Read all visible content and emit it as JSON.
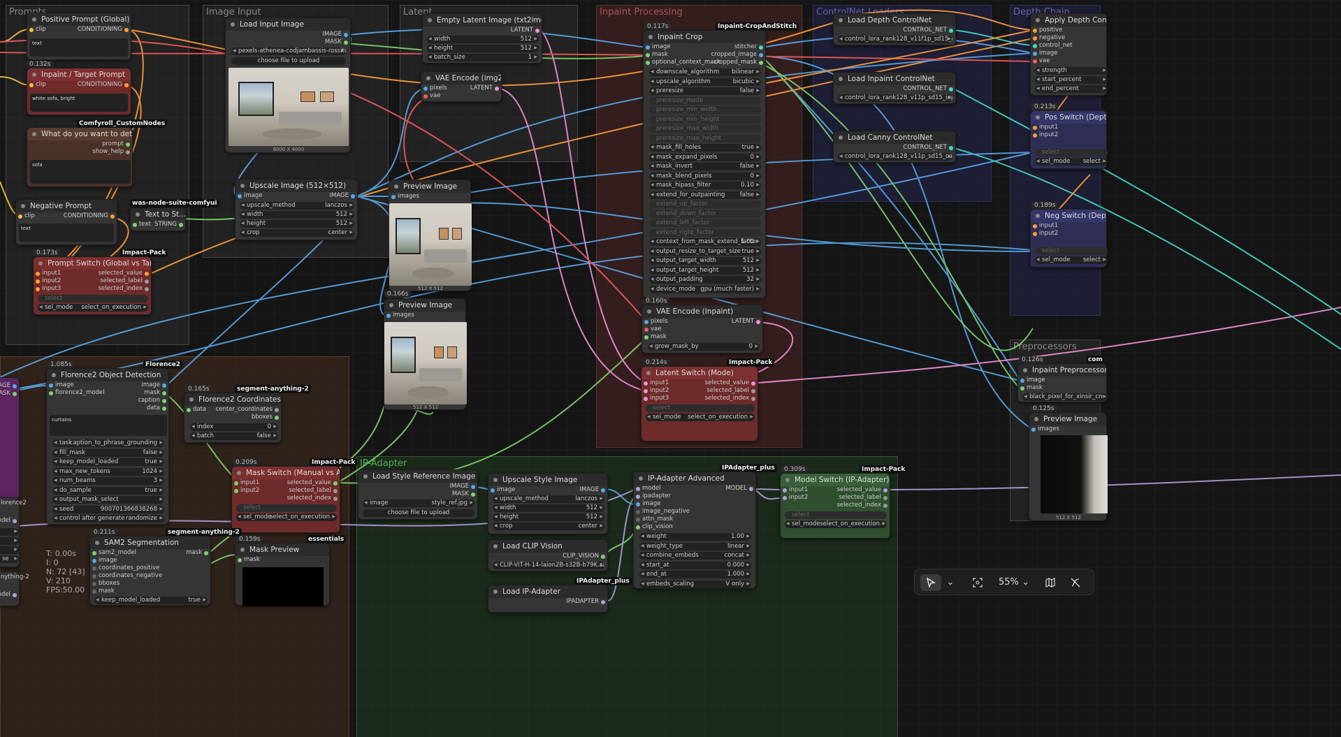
{
  "groups": {
    "prompts": "Prompts",
    "image_input": "Image Input",
    "latent": "Latent",
    "inpaint": "Inpaint Processing",
    "controlnet": "ControlNet Loaders",
    "depth": "Depth Chain",
    "ipadapter": "IP-Adapter",
    "preprocessors": "Preprocessors"
  },
  "nodes": {
    "pos_prompt": {
      "title": "Positive Prompt (Global)",
      "clip": "clip",
      "out": "CONDITIONING",
      "text": "text"
    },
    "inpaint_prompt": {
      "time": "0.132s",
      "title": "Inpaint / Target Prompt",
      "clip": "clip",
      "out": "CONDITIONING",
      "text": "white sofa, bright",
      "tag": "Comfyroll_CustomNodes"
    },
    "detect": {
      "title": "What do you want to detect ?",
      "o1": "prompt",
      "o2": "show_help",
      "text": "sofa"
    },
    "neg_prompt": {
      "title": "Negative Prompt",
      "clip": "clip",
      "out": "CONDITIONING",
      "text": "text",
      "tag": "was-node-suite-comfyui"
    },
    "text_to_str": {
      "title": "Text to St...",
      "in": "text",
      "out": "STRING"
    },
    "prompt_switch": {
      "time": "0.173s",
      "tag": "Impact-Pack",
      "title": "Prompt Switch (Global vs Target)",
      "i1": "input1",
      "i2": "input2",
      "i3": "input3",
      "o1": "selected_value",
      "o2": "selected_label",
      "o3": "selected_index",
      "select": "select",
      "sel_mode": "sel_mode",
      "sel_val": "select_on_execution"
    },
    "load_image": {
      "title": "Load Input Image",
      "o1": "IMAGE",
      "o2": "MASK",
      "image": "pexels-athenea-codjambassis-rossitto ...",
      "upload": "choose file to upload",
      "size": "6000 X 4000"
    },
    "upscale": {
      "title": "Upscale Image (512×512)",
      "in": "image",
      "out": "IMAGE",
      "w1l": "upscale_method",
      "w1v": "lanczos",
      "w2l": "width",
      "w2v": "512",
      "w3l": "height",
      "w3v": "512",
      "w4l": "crop",
      "w4v": "center"
    },
    "preview1": {
      "title": "Preview Image",
      "in": "images",
      "cap": "512 X 512"
    },
    "preview2": {
      "time": "0.166s",
      "title": "Preview Image",
      "in": "images",
      "cap": "512 X 512"
    },
    "empty_latent": {
      "title": "Empty Latent Image (txt2img)",
      "out": "LATENT",
      "w1l": "width",
      "w1v": "512",
      "w2l": "height",
      "w2v": "512",
      "w3l": "batch_size",
      "w3v": "1"
    },
    "vae_encode": {
      "title": "VAE Encode (img2i...",
      "i1": "pixels",
      "i2": "vae",
      "out": "LATENT"
    },
    "inpaint_crop": {
      "time": "0.117s",
      "tag": "Inpaint-CropAndStitch",
      "title": "Inpaint Crop",
      "i1": "image",
      "i2": "mask",
      "i3": "optional_context_mask",
      "o1": "stitcher",
      "o2": "cropped_image",
      "o3": "cropped_mask",
      "widgets": [
        [
          "downscale_algorithm",
          "bilinear",
          0
        ],
        [
          "upscale_algorithm",
          "bicubic",
          0
        ],
        [
          "preresize",
          "false",
          0
        ],
        [
          "preresize_mode",
          "",
          1
        ],
        [
          "preresize_min_width",
          "",
          1
        ],
        [
          "preresize_min_height",
          "",
          1
        ],
        [
          "preresize_max_width",
          "",
          1
        ],
        [
          "preresize_max_height",
          "",
          1
        ],
        [
          "mask_fill_holes",
          "true",
          0
        ],
        [
          "mask_expand_pixels",
          "0",
          0
        ],
        [
          "mask_invert",
          "false",
          0
        ],
        [
          "mask_blend_pixels",
          "0",
          0
        ],
        [
          "mask_hipass_filter",
          "0.10",
          0
        ],
        [
          "extend_for_outpainting",
          "false",
          0
        ],
        [
          "extend_up_factor",
          "",
          1
        ],
        [
          "extend_down_factor",
          "",
          1
        ],
        [
          "extend_left_factor",
          "",
          1
        ],
        [
          "extend_right_factor",
          "",
          1
        ],
        [
          "context_from_mask_extend_factor",
          "1.00",
          0
        ],
        [
          "output_resize_to_target_size",
          "true",
          0
        ],
        [
          "output_target_width",
          "512",
          0
        ],
        [
          "output_target_height",
          "512",
          0
        ],
        [
          "output_padding",
          "32",
          0
        ],
        [
          "device_mode",
          "gpu (much faster)",
          0
        ]
      ]
    },
    "vae_inpaint": {
      "time": "0.160s",
      "title": "VAE Encode (Inpaint)",
      "i1": "pixels",
      "i2": "vae",
      "i3": "mask",
      "out": "LATENT",
      "w1l": "grow_mask_by",
      "w1v": "0"
    },
    "latent_switch": {
      "time": "0.214s",
      "tag": "Impact-Pack",
      "title": "Latent Switch (Mode)",
      "i1": "input1",
      "i2": "input2",
      "i3": "input3",
      "o1": "selected_value",
      "o2": "selected_label",
      "o3": "selected_index",
      "select": "select",
      "sel_mode": "sel_mode",
      "sel_val": "select_on_execution"
    },
    "depth_cn": {
      "title": "Load Depth ControlNet",
      "out": "CONTROL_NET",
      "val": "control_lora_rank128_v11f1p_sd15_dept..."
    },
    "inpaint_cn": {
      "title": "Load Inpaint ControlNet",
      "out": "CONTROL_NET",
      "val": "control_lora_rank128_v11p_sd15_inpaint..."
    },
    "canny_cn": {
      "title": "Load Canny ControlNet",
      "out": "CONTROL_NET",
      "val": "control_lora_rank128_v11p_sd15_canny_..."
    },
    "apply_depth": {
      "title": "Apply Depth ControlNet",
      "i1": "positive",
      "i2": "negative",
      "i3": "control_net",
      "i4": "image",
      "i5": "vae",
      "w1": "strength",
      "w2": "start_percent",
      "w3": "end_percent"
    },
    "pos_switch": {
      "time": "0.213s",
      "title": "Pos Switch (Depth)",
      "i1": "input1",
      "i2": "input2",
      "select": "select",
      "sel_mode": "sel_mode",
      "sel_val": "select"
    },
    "neg_switch": {
      "time": "0.189s",
      "title": "Neg Switch (Depth)",
      "i1": "input1",
      "i2": "input2",
      "select": "select",
      "sel_mode": "sel_mode",
      "sel_val": "select"
    },
    "inpaint_pre": {
      "time": "0.126s",
      "tag": "com",
      "title": "Inpaint Preprocessor",
      "i1": "image",
      "i2": "mask",
      "val": "black_pixel_for_xinsir_cn"
    },
    "preview3": {
      "time": "0.125s",
      "title": "Preview Image",
      "in": "images",
      "cap": "512 X 512"
    },
    "florence_det": {
      "time": "1.085s",
      "tag": "Florence2",
      "title": "Florence2 Object Detection",
      "i1": "image",
      "i2": "florence2_model",
      "o1": "image",
      "o2": "mask",
      "o3": "caption",
      "o4": "data",
      "text": "curtains",
      "widgets": [
        [
          "task",
          "caption_to_phrase_grounding"
        ],
        [
          "fill_mask",
          "false"
        ],
        [
          "keep_model_loaded",
          "true"
        ],
        [
          "max_new_tokens",
          "1024"
        ],
        [
          "num_beams",
          "3"
        ],
        [
          "do_sample",
          "true"
        ],
        [
          "output_mask_select",
          ""
        ],
        [
          "seed",
          "900701366838268"
        ],
        [
          "control after generate",
          "randomize"
        ]
      ]
    },
    "florence_coords": {
      "time": "0.165s",
      "tag": "segment-anything-2",
      "title": "Florence2 Coordinates",
      "i1": "data",
      "o1": "center_coordinates",
      "o2": "bboxes",
      "w1l": "index",
      "w1v": "0",
      "w2l": "batch",
      "w2v": "false"
    },
    "mask_switch": {
      "time": "0.209s",
      "tag": "Impact-Pack",
      "title": "Mask Switch (Manual vs Auto)",
      "i1": "input1",
      "i2": "input2",
      "o1": "selected_value",
      "o2": "selected_label",
      "o3": "selected_index",
      "select": "select",
      "sel_mode": "sel_mode",
      "sel_val": "select_on_execution"
    },
    "sam2": {
      "time": "0.211s",
      "tag": "segment-anything-2",
      "title": "SAM2 Segmentation",
      "i1": "sam2_model",
      "i2": "image",
      "i3": "coordinates_positive",
      "i4": "coordinates_negative",
      "i5": "bboxes",
      "i6": "mask",
      "out": "mask",
      "w1l": "keep_model_loaded",
      "w1v": "true"
    },
    "mask_preview": {
      "time": "0.159s",
      "tag": "essentials",
      "title": "Mask Preview",
      "in": "mask"
    },
    "style_ref": {
      "title": "Load Style Reference Image",
      "o1": "IMAGE",
      "o2": "MASK",
      "image": "image",
      "val": "style_ref.jpg",
      "upload": "choose file to upload"
    },
    "upscale_style": {
      "title": "Upscale Style Image",
      "in": "image",
      "out": "IMAGE",
      "w1l": "upscale_method",
      "w1v": "lanczos",
      "w2l": "width",
      "w2v": "512",
      "w3l": "height",
      "w3v": "512",
      "w4l": "crop",
      "w4v": "center"
    },
    "clip_vision": {
      "title": "Load CLIP Vision",
      "out": "CLIP_VISION",
      "val": "CLIP-ViT-H-14-laion2B-s32B-b79K.saf..."
    },
    "ipa_loader": {
      "tag": "IPAdapter_plus",
      "title": "Load IP-Adapter",
      "out": "IPADAPTER"
    },
    "ipa_adv": {
      "tag": "IPAdapter_plus",
      "title": "IP-Adapter Advanced",
      "i1": "model",
      "i2": "ipadapter",
      "i3": "image",
      "i4": "image_negative",
      "i5": "attn_mask",
      "i6": "clip_vision",
      "out": "MODEL",
      "widgets": [
        [
          "weight",
          "1.00"
        ],
        [
          "weight_type",
          "linear"
        ],
        [
          "combine_embeds",
          "concat"
        ],
        [
          "start_at",
          "0.000"
        ],
        [
          "end_at",
          "1.000"
        ],
        [
          "embeds_scaling",
          "V only"
        ]
      ]
    },
    "model_switch": {
      "time": "0.309s",
      "tag": "Impact-Pack",
      "title": "Model Switch (IP-Adapter)",
      "i1": "input1",
      "i2": "input2",
      "o1": "selected_value",
      "o2": "selected_label",
      "o3": "selected_index",
      "select": "select",
      "sel_mode": "sel_mode",
      "sel_val": "select_on_execution"
    },
    "left_partial": {
      "a": "IMAGE",
      "b": "MASK",
      "c": "lorence2",
      "d": "model",
      "e": "nything-2",
      "f": "model",
      "g": "se"
    }
  },
  "stats": {
    "t": "T: 0.00s",
    "i": "I: 0",
    "n": "N: 72 [43]",
    "v": "V: 210",
    "fps": "FPS:50.00"
  },
  "toolbar": {
    "zoom": "55%"
  },
  "colors": {
    "clip": "#f0c140",
    "cond": "#ff9e3c",
    "image": "#58a7e8",
    "mask": "#7ed36f",
    "latent": "#f08fd8",
    "model": "#b39ddb",
    "red_wire": "#f05a5a",
    "control": "#45d8c8"
  }
}
